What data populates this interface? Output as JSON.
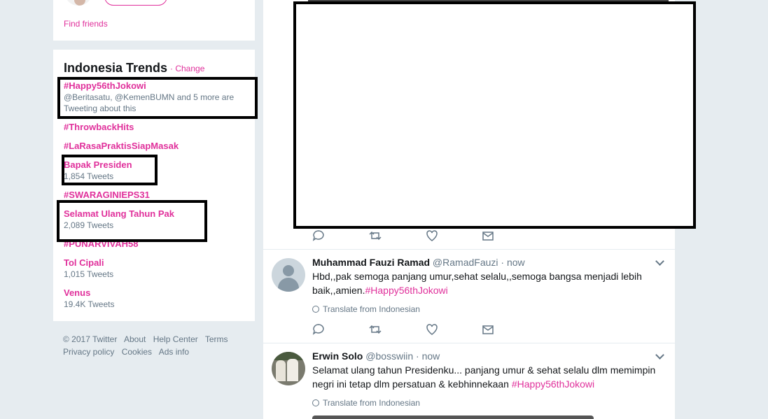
{
  "sidebar": {
    "find_friends": "Find friends",
    "trends": {
      "title": "Indonesia Trends",
      "change": "· Change",
      "items": [
        {
          "name": "#Happy56thJokowi",
          "meta": "@Beritasatu, @KemenBUMN and 5 more are Tweeting about this"
        },
        {
          "name": "#ThrowbackHits",
          "meta": ""
        },
        {
          "name": "#LaRasaPraktisSiapMasak",
          "meta": ""
        },
        {
          "name": "Bapak Presiden",
          "meta": "1,854 Tweets"
        },
        {
          "name": "#SWARAGINIEPS31",
          "meta": ""
        },
        {
          "name": "Selamat Ulang Tahun Pak",
          "meta": "2,089 Tweets"
        },
        {
          "name": "#PUNARVIVAH58",
          "meta": ""
        },
        {
          "name": "Tol Cipali",
          "meta": "1,015 Tweets"
        },
        {
          "name": "Venus",
          "meta": "19.4K Tweets"
        }
      ]
    }
  },
  "footer": {
    "links": [
      "© 2017 Twitter",
      "About",
      "Help Center",
      "Terms",
      "Privacy policy",
      "Cookies",
      "Ads info"
    ]
  },
  "tweets": [
    {
      "name": "Muhammad Fauzi Ramad",
      "handle": "@RamadFauzi",
      "time": "· now",
      "text": "Hbd,,pak semoga panjang umur,sehat selalu,,semoga bangsa menjadi lebih baik,,amien.",
      "hashtag": "#Happy56thJokowi",
      "translate": "Translate from Indonesian"
    },
    {
      "name": "Erwin Solo",
      "handle": "@bosswiin",
      "time": "· now",
      "text": "Selamat ulang tahun Presidenku... panjang umur & sehat selalu dlm memimpin negri ini tetap dlm persatuan & kebhinnekaan ",
      "hashtag": "#Happy56thJokowi",
      "translate": "Translate from Indonesian"
    }
  ],
  "colors": {
    "accent": "#e0309b",
    "background": "#e6ecf0",
    "muted": "#657786"
  }
}
